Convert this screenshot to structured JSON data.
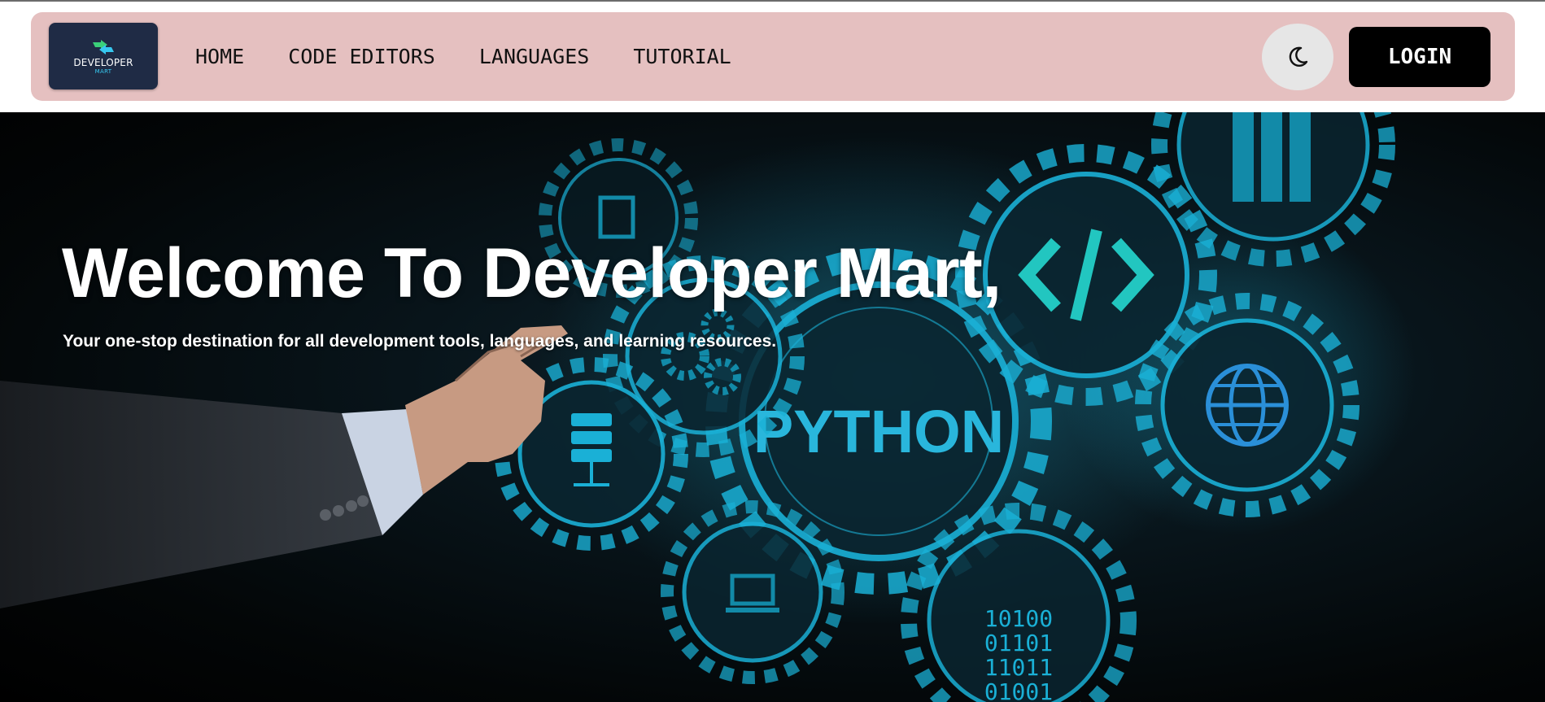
{
  "brand": {
    "logo_name": "DEVELOPER",
    "logo_sub": "MART"
  },
  "nav": {
    "items": [
      {
        "label": "HOME"
      },
      {
        "label": "CODE EDITORS"
      },
      {
        "label": "LANGUAGES"
      },
      {
        "label": "TUTORIAL"
      }
    ],
    "theme_toggle_icon": "moon-icon",
    "login_label": "LOGIN"
  },
  "hero": {
    "title": "Welcome To Developer Mart,",
    "subtitle": "Your one-stop destination for all development tools, languages, and learning resources.",
    "image_labels": {
      "python": "PYTHON",
      "binary": [
        "10100",
        "01101",
        "11011",
        "01001"
      ],
      "code_glyph": "</>"
    },
    "image_icons": [
      "gear-icon",
      "code-icon",
      "globe-icon",
      "database-icon",
      "laptop-icon",
      "server-icon",
      "binary-icon"
    ]
  },
  "colors": {
    "navbar_bg": "#e5c0c0",
    "logo_bg": "#1f2b45",
    "login_bg": "#000000",
    "toggle_bg": "#e6e6e6",
    "gear_accent": "#1ab0d6"
  }
}
